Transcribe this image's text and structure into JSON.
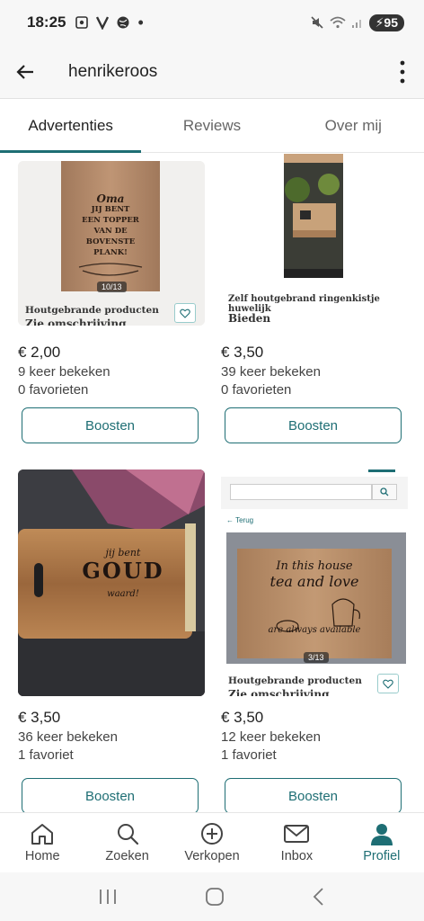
{
  "status_bar": {
    "time": "18:25",
    "battery": "95"
  },
  "header": {
    "username": "henrikeroos"
  },
  "tabs": [
    {
      "label": "Advertenties",
      "active": true
    },
    {
      "label": "Reviews",
      "active": false
    },
    {
      "label": "Over mij",
      "active": false
    }
  ],
  "listings": [
    {
      "image": {
        "engraving_lines": [
          "Oma",
          "JIJ BENT",
          "EEN TOPPER",
          "VAN DE",
          "BOVENSTE",
          "PLANK!"
        ],
        "counter": "10/13",
        "caption_line1": "Houtgebrande producten",
        "caption_line2": "Zie omschrijving"
      },
      "price": "€ 2,00",
      "views": "9 keer bekeken",
      "favorites": "0 favorieten",
      "boost_label": "Boosten"
    },
    {
      "image": {
        "caption_line1": "Zelf houtgebrand ringenkistje huwelijk",
        "caption_line2": "Bieden"
      },
      "price": "€ 3,50",
      "views": "39 keer bekeken",
      "favorites": "0 favorieten",
      "boost_label": "Boosten"
    },
    {
      "image": {
        "engraving_lines": [
          "jij bent",
          "GOUD",
          "waard!"
        ]
      },
      "price": "€ 3,50",
      "views": "36 keer bekeken",
      "favorites": "1 favoriet",
      "boost_label": "Boosten"
    },
    {
      "image": {
        "back_link": "Terug",
        "engraving_lines": [
          "In this house",
          "tea and love",
          "are always available"
        ],
        "counter": "3/13",
        "caption_line1": "Houtgebrande producten",
        "caption_line2": "Zie omschrijving"
      },
      "price": "€ 3,50",
      "views": "12 keer bekeken",
      "favorites": "1 favoriet",
      "boost_label": "Boosten"
    }
  ],
  "bottom_nav": [
    {
      "label": "Home",
      "icon": "home-icon",
      "active": false
    },
    {
      "label": "Zoeken",
      "icon": "search-icon",
      "active": false
    },
    {
      "label": "Verkopen",
      "icon": "plus-circle-icon",
      "active": false
    },
    {
      "label": "Inbox",
      "icon": "mail-icon",
      "active": false
    },
    {
      "label": "Profiel",
      "icon": "person-icon",
      "active": true
    }
  ],
  "colors": {
    "accent": "#1e6e74",
    "text": "#222222",
    "muted": "#444444"
  }
}
